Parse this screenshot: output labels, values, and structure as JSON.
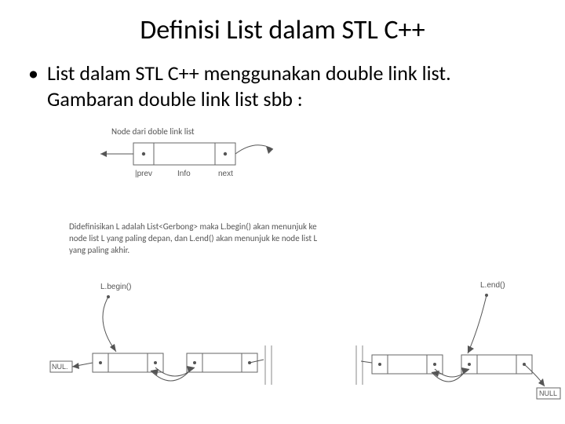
{
  "title": "Definisi List dalam STL C++",
  "bullet": "List dalam STL C++ menggunakan double link list. Gambaran double link list sbb :",
  "node_caption": "Node dari doble link list",
  "node_labels": {
    "prev": "|prev",
    "info": "Info",
    "next": "next"
  },
  "definition_text": "Didefinisikan L adalah List<Gerbong> maka L.begin() akan menunjuk ke node list L yang paling depan, dan L.end() akan menunjuk ke node list L yang paling akhir.",
  "begin_label": "L.begin()",
  "end_label": "L.end()",
  "null_left": "NUL.",
  "null_right": "NULL"
}
